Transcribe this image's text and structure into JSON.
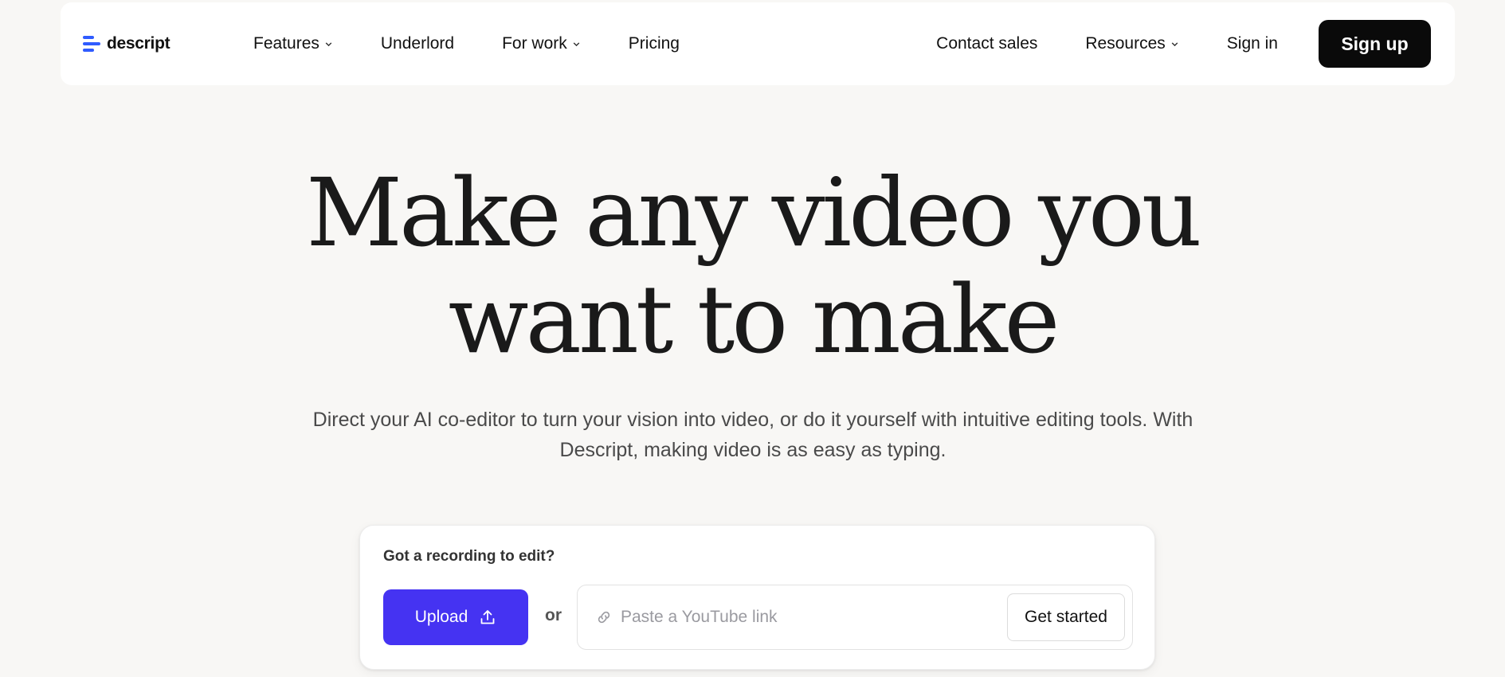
{
  "brand": {
    "name": "descript",
    "accent": "#2f5bff"
  },
  "nav": {
    "left": [
      {
        "label": "Features",
        "dropdown": true
      },
      {
        "label": "Underlord",
        "dropdown": false
      },
      {
        "label": "For work",
        "dropdown": true
      },
      {
        "label": "Pricing",
        "dropdown": false
      }
    ],
    "right": [
      {
        "label": "Contact sales",
        "dropdown": false
      },
      {
        "label": "Resources",
        "dropdown": true
      },
      {
        "label": "Sign in",
        "dropdown": false
      }
    ],
    "signup_label": "Sign up"
  },
  "hero": {
    "title_line1": "Make any video you",
    "title_line2": "want to make",
    "subtitle": "Direct your AI co-editor to turn your vision into video, or do it yourself with intuitive editing tools. With Descript, making video is as easy as typing."
  },
  "card": {
    "label": "Got a recording to edit?",
    "upload_label": "Upload",
    "upload_icon": "upload-icon",
    "or_text": "or",
    "link_placeholder": "Paste a YouTube link",
    "link_value": "",
    "link_icon": "link-icon",
    "get_started_label": "Get started",
    "upload_color": "#4533f2"
  }
}
